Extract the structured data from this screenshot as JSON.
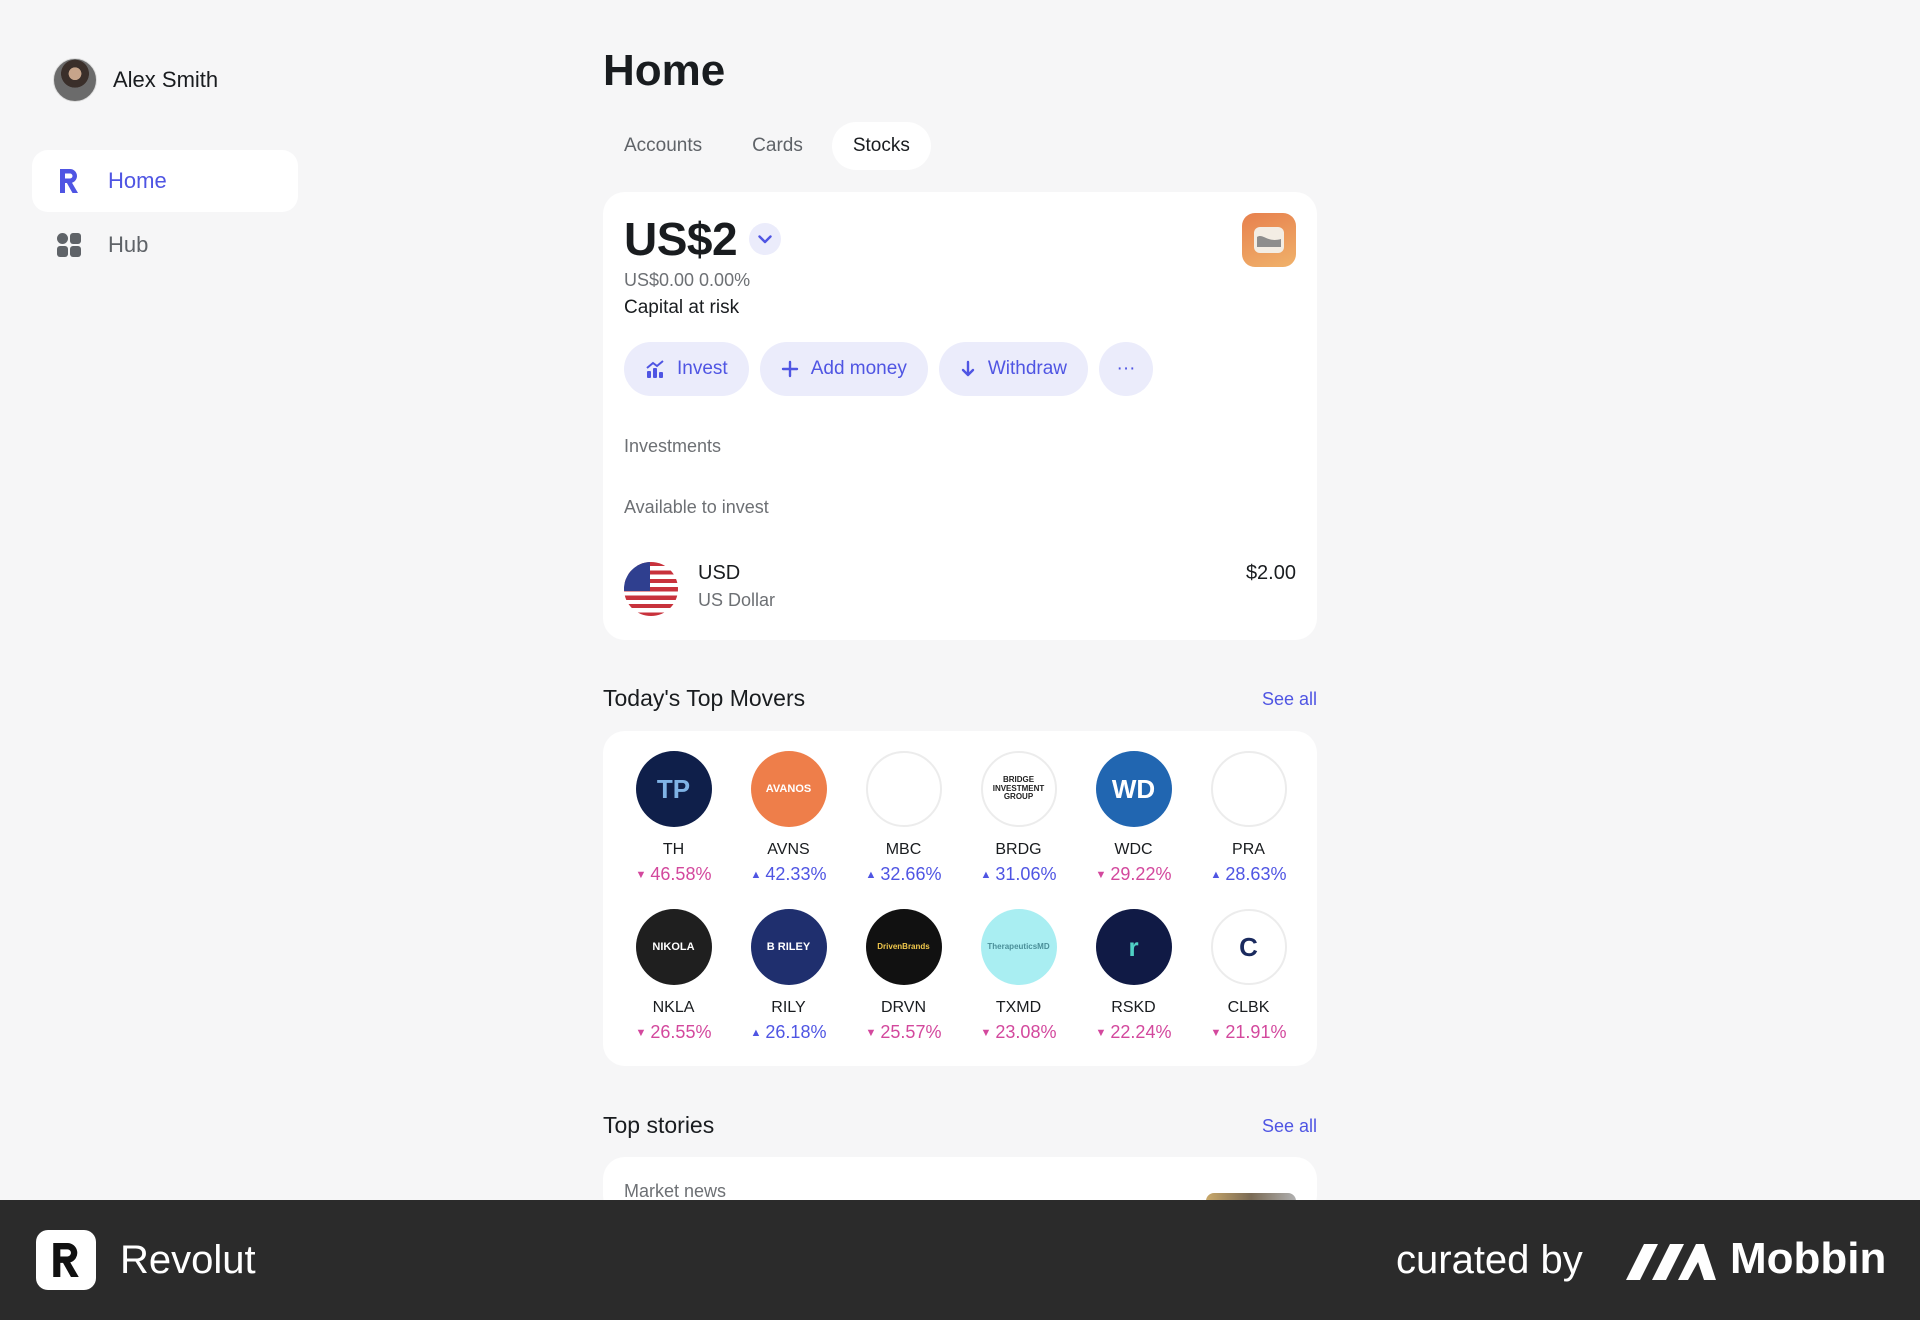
{
  "user": {
    "name": "Alex Smith"
  },
  "sidebar": {
    "items": [
      {
        "label": "Home",
        "icon": "revolut-r-icon",
        "active": true
      },
      {
        "label": "Hub",
        "icon": "grid-icon",
        "active": false
      }
    ]
  },
  "main": {
    "title": "Home",
    "tabs": [
      {
        "label": "Accounts",
        "active": false
      },
      {
        "label": "Cards",
        "active": false
      },
      {
        "label": "Stocks",
        "active": true
      }
    ],
    "balance": {
      "amount": "US$2",
      "change": "US$0.00 0.00%",
      "risk_note": "Capital at risk"
    },
    "actions": {
      "invest": "Invest",
      "add_money": "Add money",
      "withdraw": "Withdraw",
      "more": "···"
    },
    "investments_label": "Investments",
    "available_label": "Available to invest",
    "currency": {
      "code": "USD",
      "name": "US Dollar",
      "amount": "$2.00"
    },
    "top_movers": {
      "title": "Today's Top Movers",
      "see_all": "See all",
      "items": [
        {
          "ticker": "TH",
          "change": "46.58%",
          "direction": "down",
          "logo_text": "TP",
          "bg": "#0f1f4a",
          "fg": "#7fb3e6"
        },
        {
          "ticker": "AVNS",
          "change": "42.33%",
          "direction": "up",
          "logo_text": "AVANOS",
          "bg": "#ee7e4a",
          "fg": "#ffffff"
        },
        {
          "ticker": "MBC",
          "change": "32.66%",
          "direction": "up",
          "logo_text": "",
          "bg": "#ffffff",
          "fg": "#b9a583"
        },
        {
          "ticker": "BRDG",
          "change": "31.06%",
          "direction": "up",
          "logo_text": "BRIDGE INVESTMENT GROUP",
          "bg": "#ffffff",
          "fg": "#222222"
        },
        {
          "ticker": "WDC",
          "change": "29.22%",
          "direction": "down",
          "logo_text": "WD",
          "bg": "#2166b1",
          "fg": "#ffffff"
        },
        {
          "ticker": "PRA",
          "change": "28.63%",
          "direction": "up",
          "logo_text": "",
          "bg": "#ffffff",
          "fg": "#2e8a3c"
        },
        {
          "ticker": "NKLA",
          "change": "26.55%",
          "direction": "down",
          "logo_text": "NIKOLA",
          "bg": "#1f1f1f",
          "fg": "#ffffff"
        },
        {
          "ticker": "RILY",
          "change": "26.18%",
          "direction": "up",
          "logo_text": "B RILEY",
          "bg": "#1f2f6e",
          "fg": "#ffffff"
        },
        {
          "ticker": "DRVN",
          "change": "25.57%",
          "direction": "down",
          "logo_text": "DrivenBrands",
          "bg": "#111111",
          "fg": "#f2c94c"
        },
        {
          "ticker": "TXMD",
          "change": "23.08%",
          "direction": "down",
          "logo_text": "TherapeuticsMD",
          "bg": "#a9eef2",
          "fg": "#4a8f99"
        },
        {
          "ticker": "RSKD",
          "change": "22.24%",
          "direction": "down",
          "logo_text": "r",
          "bg": "#101a45",
          "fg": "#4fd1c5"
        },
        {
          "ticker": "CLBK",
          "change": "21.91%",
          "direction": "down",
          "logo_text": "C",
          "bg": "#ffffff",
          "fg": "#1a2a5e"
        }
      ]
    },
    "top_stories": {
      "title": "Top stories",
      "see_all": "See all",
      "market_news": "Market news"
    }
  },
  "footer": {
    "brand": "Revolut",
    "curated_by": "curated by",
    "curator": "Mobbin"
  },
  "colors": {
    "accent": "#4f55e3",
    "down": "#d3489d",
    "background": "#f6f6f7",
    "footer": "#2b2b2b"
  }
}
